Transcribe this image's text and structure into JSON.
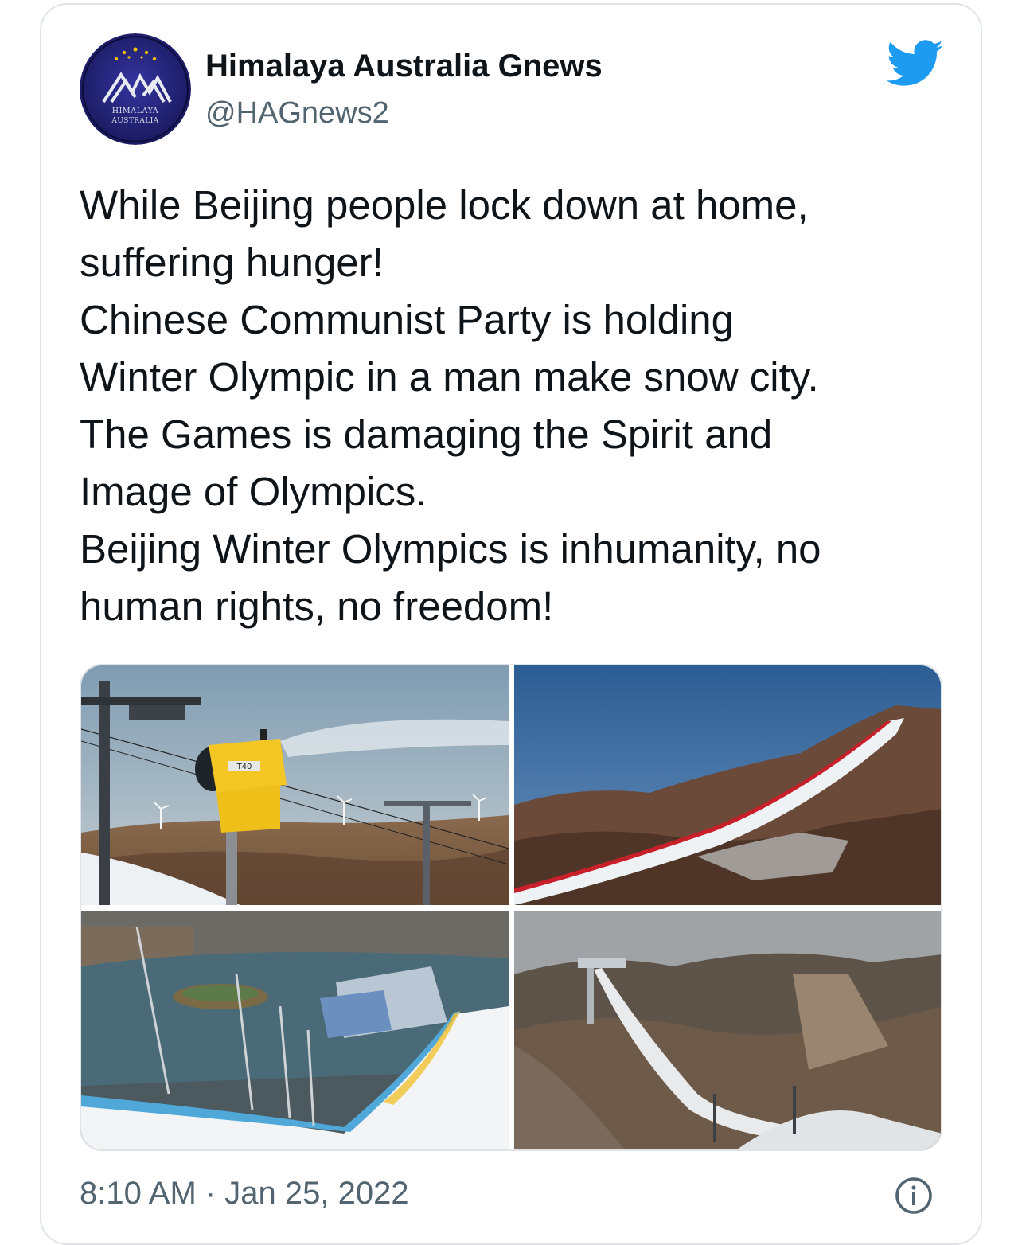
{
  "author": {
    "name": "Himalaya Australia Gnews",
    "handle": "@HAGnews2",
    "avatar_text_line1": "HIMALAYA",
    "avatar_text_line2": "AUSTRALIA"
  },
  "tweet": {
    "lines": [
      "While Beijing people lock down at home,",
      "suffering hunger!",
      "Chinese Communist Party is holding",
      "Winter Olympic in a man make snow city.",
      "The Games is damaging the Spirit and",
      "Image of Olympics.",
      "Beijing Winter Olympics is inhumanity, no",
      "human rights, no freedom!"
    ],
    "timestamp": "8:10 AM · Jan 25, 2022",
    "media": [
      {
        "icon": "snow-cannon-photo",
        "label": "T40"
      },
      {
        "icon": "ski-slope-photo"
      },
      {
        "icon": "big-air-venue-photo"
      },
      {
        "icon": "ski-jump-photo"
      }
    ]
  },
  "icons": {
    "twitter": "twitter-bird-icon",
    "info": "info-icon"
  },
  "colors": {
    "twitter_blue": "#1d9bf0",
    "text": "#0f1419",
    "secondary": "#536471",
    "border": "#dfe3e7",
    "avatar_bg": "#23237a"
  }
}
